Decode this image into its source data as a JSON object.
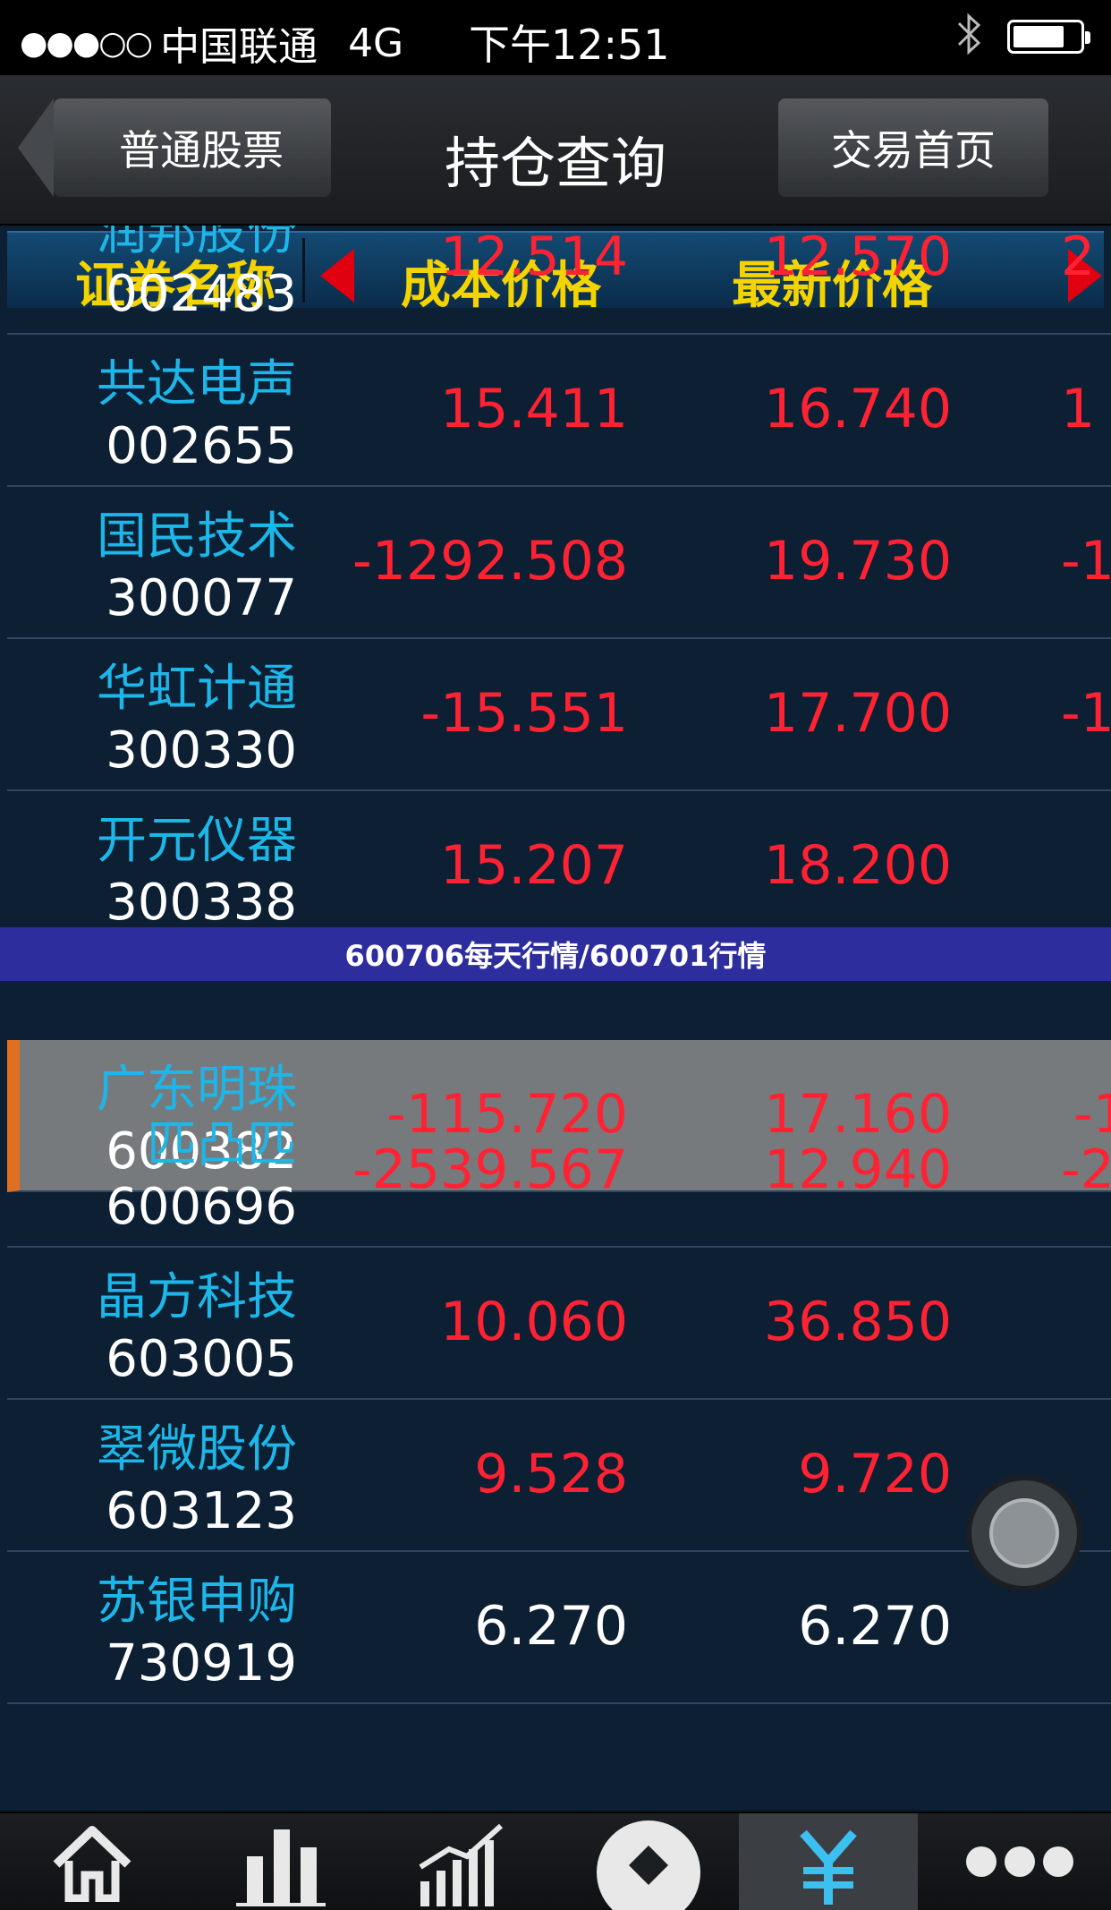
{
  "status_bar": {
    "signal": "●●●○○",
    "carrier": "中国联通",
    "network": "4G",
    "time": "下午12:51",
    "bluetooth_icon": "bluetooth-icon",
    "battery_icon": "battery-icon"
  },
  "navbar": {
    "back_label": "普通股票",
    "title": "持仓查询",
    "right_label": "交易首页"
  },
  "table": {
    "headers": {
      "name": "证券名称",
      "cost": "成本价格",
      "latest": "最新价格"
    },
    "rows": [
      {
        "name": "润邦股份",
        "code": "002483",
        "cost": "12.514",
        "latest": "12.570",
        "extra": "2"
      },
      {
        "name": "共达电声",
        "code": "002655",
        "cost": "15.411",
        "latest": "16.740",
        "extra": "1"
      },
      {
        "name": "国民技术",
        "code": "300077",
        "cost": "-1292.508",
        "latest": "19.730",
        "extra": "-1"
      },
      {
        "name": "华虹计通",
        "code": "300330",
        "cost": "-15.551",
        "latest": "17.700",
        "extra": "-1"
      },
      {
        "name": "开元仪器",
        "code": "300338",
        "cost": "15.207",
        "latest": "18.200",
        "extra": ""
      },
      {
        "name": "广东明珠",
        "code": "600382",
        "cost": "-115.720",
        "latest": "17.160",
        "extra": "-1"
      },
      {
        "name": "匹凸匹",
        "code": "600696",
        "cost": "-2539.567",
        "latest": "12.940",
        "extra": "-2"
      },
      {
        "name": "晶方科技",
        "code": "603005",
        "cost": "10.060",
        "latest": "36.850",
        "extra": ""
      },
      {
        "name": "翠微股份",
        "code": "603123",
        "cost": "9.528",
        "latest": "9.720",
        "extra": ""
      },
      {
        "name": "苏银申购",
        "code": "730919",
        "cost": "6.270",
        "latest": "6.270",
        "extra": ""
      }
    ]
  },
  "banner": {
    "text": "600706每天行情/600701行情"
  },
  "tabbar": {
    "icons": [
      "home-icon",
      "bar-chart-icon",
      "trend-chart-icon",
      "logo-icon",
      "yen-icon",
      "more-icon"
    ]
  }
}
